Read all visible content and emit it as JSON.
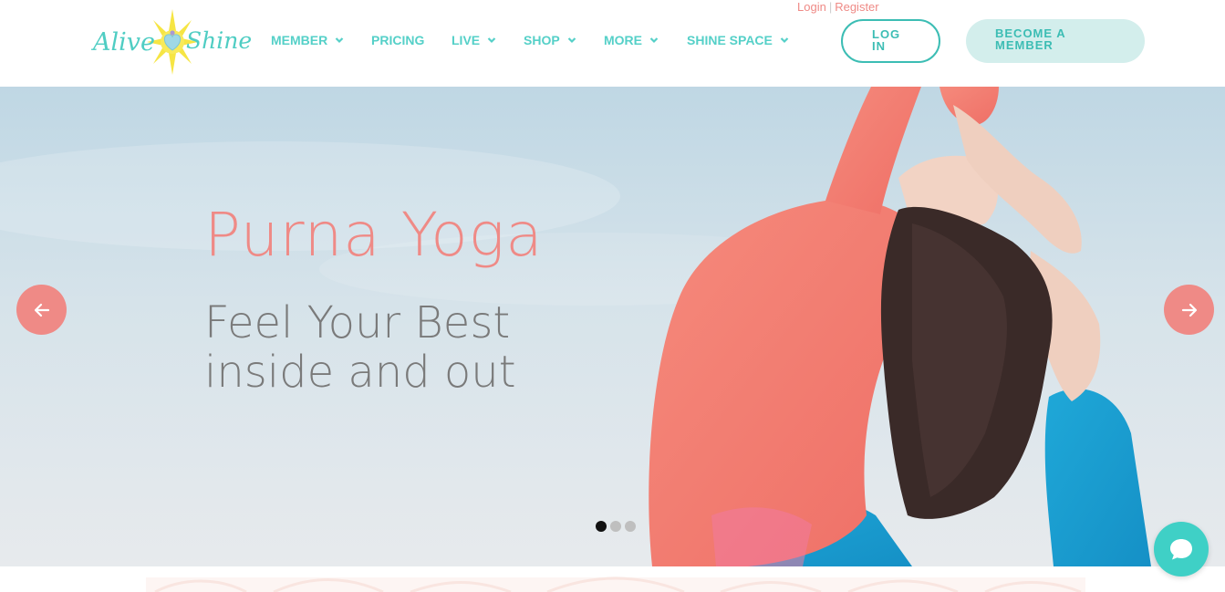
{
  "header": {
    "top_links": {
      "login": "Login",
      "separator": "|",
      "register": "Register"
    },
    "logo": {
      "text_left": "Alive",
      "text_right": "Shine",
      "icon": "sun-heart-logo-icon"
    },
    "nav": [
      {
        "label": "MEMBER",
        "has_dropdown": true
      },
      {
        "label": "PRICING",
        "has_dropdown": false
      },
      {
        "label": "LIVE",
        "has_dropdown": true
      },
      {
        "label": "SHOP",
        "has_dropdown": true
      },
      {
        "label": "MORE",
        "has_dropdown": true
      },
      {
        "label": "SHINE SPACE",
        "has_dropdown": true
      }
    ],
    "login_button": {
      "line1": "LOG",
      "line2": "IN"
    },
    "become_button": {
      "line1": "BECOME A",
      "line2": "MEMBER"
    }
  },
  "hero": {
    "title": "Purna Yoga",
    "subtitle": "Feel Your Best inside and out",
    "prev_icon": "arrow-left-icon",
    "next_icon": "arrow-right-icon",
    "slides": {
      "count": 3,
      "active": 1
    }
  },
  "chat": {
    "icon": "chat-bubble-icon"
  },
  "colors": {
    "accent_teal": "#55d0c8",
    "accent_coral": "#ef8a86",
    "button_teal_dark": "#3cbdb4",
    "become_bg": "#d3eeec",
    "subtitle_gray": "#7a7a7a",
    "chat_bg": "#3fd0c6"
  }
}
